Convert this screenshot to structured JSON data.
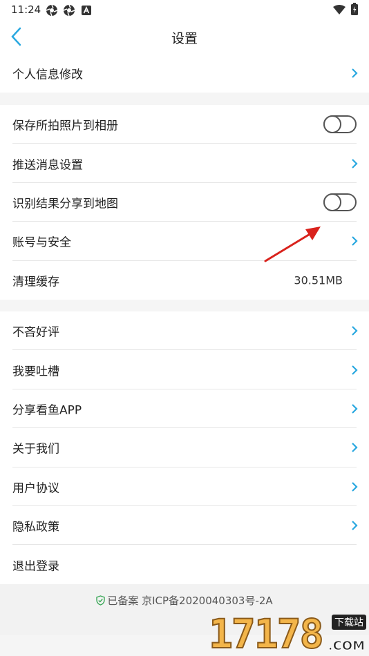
{
  "statusbar": {
    "time": "11:24",
    "icons": [
      "aperture-icon",
      "aperture-icon",
      "a-badge-icon",
      "wifi-icon",
      "battery-icon"
    ]
  },
  "header": {
    "title": "设置",
    "back_icon": "chevron-left-icon"
  },
  "groups": [
    {
      "items": [
        {
          "label": "个人信息修改",
          "kind": "link"
        }
      ]
    },
    {
      "items": [
        {
          "label": "保存所拍照片到相册",
          "kind": "toggle",
          "on": false
        },
        {
          "label": "推送消息设置",
          "kind": "link"
        },
        {
          "label": "识别结果分享到地图",
          "kind": "toggle",
          "on": false
        },
        {
          "label": "账号与安全",
          "kind": "link"
        },
        {
          "label": "清理缓存",
          "kind": "value",
          "value": "30.51MB"
        }
      ]
    },
    {
      "items": [
        {
          "label": "不吝好评",
          "kind": "link"
        },
        {
          "label": "我要吐槽",
          "kind": "link"
        },
        {
          "label": "分享看鱼APP",
          "kind": "link"
        },
        {
          "label": "关于我们",
          "kind": "link"
        },
        {
          "label": "用户协议",
          "kind": "link"
        },
        {
          "label": "隐私政策",
          "kind": "link"
        },
        {
          "label": "退出登录",
          "kind": "plain"
        }
      ]
    }
  ],
  "footer": {
    "icp_text": "已备案  京ICP备2020040303号-2A",
    "icon": "shield-check-icon"
  },
  "watermark": {
    "number": "17178",
    "badge": "下载站",
    "domain": ".COM"
  },
  "colors": {
    "accent": "#29a8e0",
    "divider": "#e6e6e6",
    "arrow": "#d9221c",
    "icp_shield": "#3aa757"
  }
}
